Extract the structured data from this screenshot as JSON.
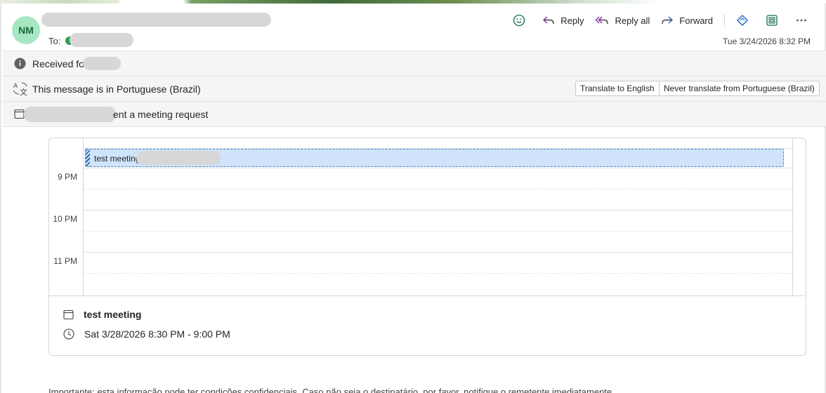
{
  "header": {
    "avatar_initials": "NM",
    "to_label": "To:",
    "datetime": "Tue 3/24/2026 8:32 PM",
    "actions": {
      "reply": "Reply",
      "reply_all": "Reply all",
      "forward": "Forward"
    }
  },
  "received_bar": {
    "text": "Received fo"
  },
  "translate_bar": {
    "text": "This message is in Portuguese (Brazil)",
    "translate_button": "Translate to English",
    "never_translate_button": "Never translate from Portuguese (Brazil)"
  },
  "meeting_bar": {
    "text": "ent a meeting request"
  },
  "calendar": {
    "event_title": "test meeting",
    "hours": [
      "9 PM",
      "10 PM",
      "11 PM"
    ]
  },
  "meeting_details": {
    "title": "test meeting",
    "time": "Sat 3/28/2026 8:30 PM - 9:00 PM"
  },
  "body": {
    "preview": "Importante: esta informação pode ter condições confidenciais. Caso não seja o destinatário, por favor, notifique o remetente imediatamente."
  },
  "colors": {
    "avatar_bg": "#a8e6c3",
    "avatar_text": "#1a6a3b",
    "reply_all_accent": "#8a2da5",
    "forward_accent": "#1a66c7",
    "event_bg": "#cfe4fa"
  }
}
